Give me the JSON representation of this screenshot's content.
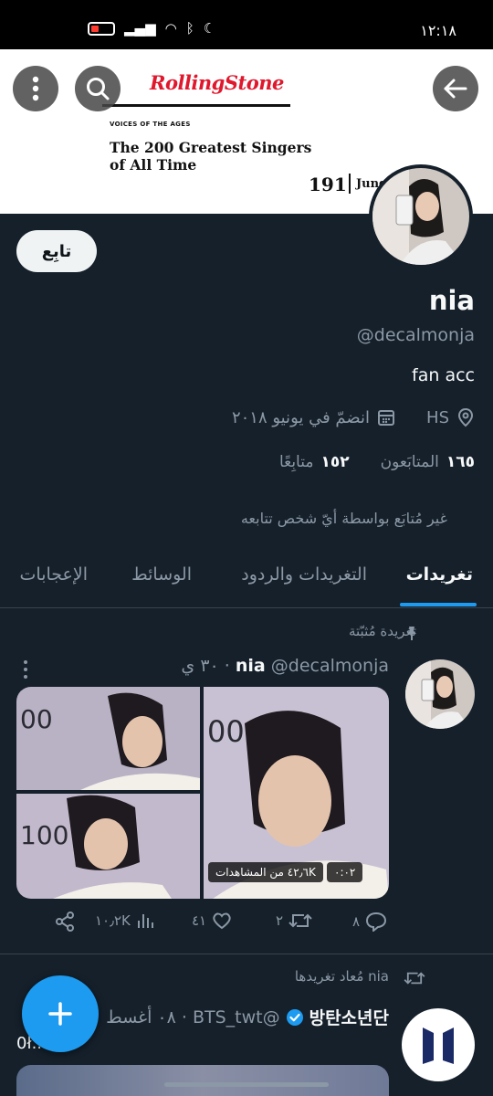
{
  "status_bar": {
    "time": "١٢:١٨"
  },
  "banner": {
    "logo": "RollingStone",
    "kicker": "VOICES OF THE AGES",
    "headline": "The 200 Greatest Singers of All Time",
    "rank": "191",
    "singer_partial": "Jung"
  },
  "profile": {
    "follow_label": "تابِع",
    "name": "nia",
    "handle": "@decalmonja",
    "bio": "fan acc",
    "location": "HS",
    "joined": "انضمّ في يونيو ٢٠١٨",
    "followers_count": "١٦٥",
    "followers_label": "المتابَعون",
    "following_count": "١٥٢",
    "following_label": "متابِعًا",
    "not_followed": "غير مُتابَع بواسطة أيّ شخص تتابعه"
  },
  "tabs": [
    "تغريدات",
    "التغريدات والردود",
    "الوسائط",
    "الإعجابات"
  ],
  "pinned_tweet": {
    "pinned_label": "تغريدة مُثبّتة",
    "name": "nia",
    "handle_time": "@decalmonja · ٣٠ ي",
    "video_duration": "٠:٠٢",
    "views": "٤٢٫٦K من المشاهدات",
    "replies": "٨",
    "retweets": "٢",
    "likes": "٤١",
    "views_count": "١٠٫٢K"
  },
  "retweet": {
    "label": "nia مُعاد تغريدها",
    "name": "방탄소년단",
    "handle_time": "@BTS_twt · ٠٨ أغسط",
    "text_partial": "0ł..."
  },
  "colors": {
    "background": "#15202b",
    "accent": "#1d9bf0",
    "muted": "#8b98a5",
    "border": "#38444d",
    "rs_red": "#e0182d"
  }
}
